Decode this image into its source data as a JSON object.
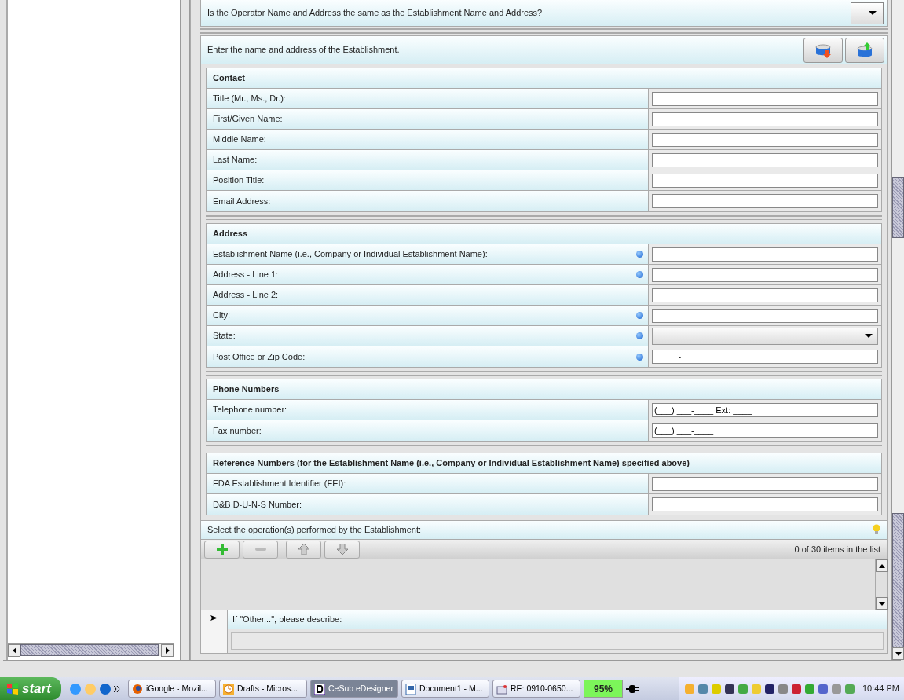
{
  "question": {
    "text": "Is the Operator Name and Address the same as the Establishment Name and Address?"
  },
  "section": {
    "instruction": "Enter the name and address of the Establishment.",
    "groups": [
      {
        "title": "Contact",
        "rows": [
          {
            "label": "Title (Mr., Ms., Dr.):",
            "required": false,
            "kind": "text"
          },
          {
            "label": "First/Given Name:",
            "required": false,
            "kind": "text"
          },
          {
            "label": "Middle Name:",
            "required": false,
            "kind": "text"
          },
          {
            "label": "Last Name:",
            "required": false,
            "kind": "text"
          },
          {
            "label": "Position Title:",
            "required": false,
            "kind": "text"
          },
          {
            "label": "Email Address:",
            "required": false,
            "kind": "text"
          }
        ]
      },
      {
        "title": "Address",
        "rows": [
          {
            "label": "Establishment Name (i.e., Company or Individual Establishment Name):",
            "required": true,
            "kind": "text"
          },
          {
            "label": "Address - Line 1:",
            "required": true,
            "kind": "text"
          },
          {
            "label": "Address - Line 2:",
            "required": false,
            "kind": "text"
          },
          {
            "label": "City:",
            "required": true,
            "kind": "text"
          },
          {
            "label": "State:",
            "required": true,
            "kind": "select"
          },
          {
            "label": "Post Office or Zip Code:",
            "required": true,
            "kind": "text",
            "value": "_____-____"
          }
        ]
      },
      {
        "title": "Phone Numbers",
        "rows": [
          {
            "label": "Telephone number:",
            "required": false,
            "kind": "text",
            "value": "(___) ___-____ Ext: ____"
          },
          {
            "label": "Fax number:",
            "required": false,
            "kind": "text",
            "value": "(___) ___-____"
          }
        ]
      },
      {
        "title": "Reference Numbers (for the Establishment Name (i.e., Company or Individual Establishment Name) specified above)",
        "rows": [
          {
            "label": "FDA Establishment Identifier (FEI):",
            "required": false,
            "kind": "text"
          },
          {
            "label": "D&B D-U-N-S Number:",
            "required": false,
            "kind": "text"
          }
        ]
      }
    ]
  },
  "operations": {
    "label": "Select the operation(s) performed by the Establishment:",
    "count": "0 of 30 items in the list"
  },
  "other": {
    "label": "If \"Other...\", please describe:"
  },
  "taskbar": {
    "start": "start",
    "tasks": [
      {
        "label": "iGoogle - Mozil...",
        "selected": false,
        "kind": "firefox"
      },
      {
        "label": "Drafts - Micros...",
        "selected": false,
        "kind": "clock"
      },
      {
        "label": "CeSub eDesigner",
        "selected": true,
        "kind": "d"
      },
      {
        "label": "Document1 - M...",
        "selected": false,
        "kind": "doc"
      },
      {
        "label": "RE: 0910-0650...",
        "selected": false,
        "kind": "mail"
      }
    ],
    "battery": "95%",
    "clock": "10:44 PM"
  }
}
